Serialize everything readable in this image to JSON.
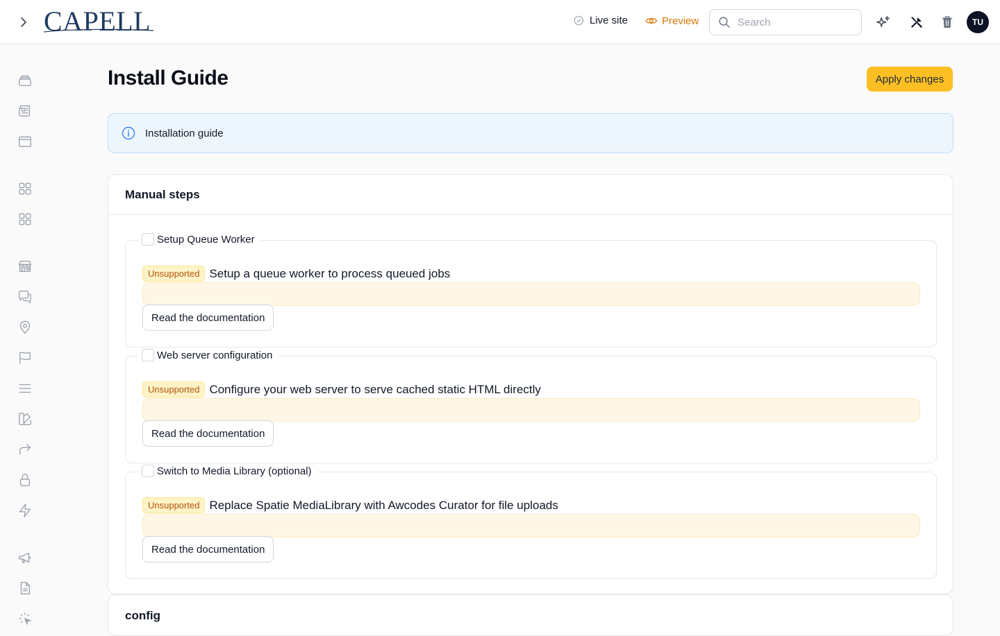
{
  "header": {
    "logo_text": "CAPELL",
    "live_site_label": "Live site",
    "preview_label": "Preview",
    "search_placeholder": "Search",
    "avatar_initials": "TU"
  },
  "sidebar": {
    "items": [
      {
        "icon": "stack-icon"
      },
      {
        "icon": "newspaper-icon"
      },
      {
        "icon": "calendar-icon"
      },
      {
        "icon": "grid-icon"
      },
      {
        "icon": "grid-icon"
      },
      {
        "icon": "storefront-icon"
      },
      {
        "icon": "chat-icon"
      },
      {
        "icon": "map-pin-icon"
      },
      {
        "icon": "flag-icon"
      },
      {
        "icon": "menu-lines-icon"
      },
      {
        "icon": "swatch-icon"
      },
      {
        "icon": "redirect-icon"
      },
      {
        "icon": "lock-icon"
      },
      {
        "icon": "bolt-icon"
      },
      {
        "icon": "megaphone-icon"
      },
      {
        "icon": "document-icon"
      },
      {
        "icon": "cursor-click-icon"
      }
    ]
  },
  "main": {
    "title": "Install Guide",
    "apply_button": "Apply changes",
    "info_text": "Installation guide",
    "manual_steps": {
      "heading": "Manual steps",
      "steps": [
        {
          "legend": "Setup Queue Worker",
          "badge": "Unsupported",
          "description": "Setup a queue worker to process queued jobs",
          "button": "Read the documentation"
        },
        {
          "legend": "Web server configuration",
          "badge": "Unsupported",
          "description": "Configure your web server to serve cached static HTML directly",
          "button": "Read the documentation"
        },
        {
          "legend": "Switch to Media Library (optional)",
          "badge": "Unsupported",
          "description": "Replace Spatie MediaLibrary with Awcodes Curator for file uploads",
          "button": "Read the documentation"
        }
      ]
    },
    "config_heading": "config"
  },
  "colors": {
    "accent": "#fbbf24",
    "preview": "#d97706",
    "info_bg": "#eef6fd",
    "badge_text": "#b45309"
  }
}
